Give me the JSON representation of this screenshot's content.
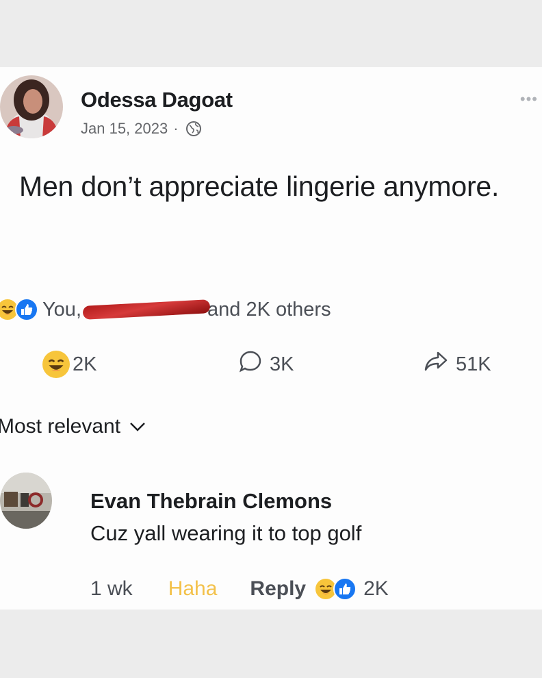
{
  "post": {
    "author": "Odessa Dagoat",
    "date": "Jan 15, 2023",
    "separator": "·",
    "privacy_icon": "globe-icon",
    "text": "Men don’t appreciate lingerie anymore.",
    "more_icon": "more-options-icon"
  },
  "reactions_summary": {
    "prefix": "You,",
    "suffix": "and 2K others",
    "icons": [
      "haha-icon",
      "like-icon"
    ]
  },
  "actions": {
    "haha_count": "2K",
    "comment_count": "3K",
    "share_count": "51K"
  },
  "comments_sort": {
    "label": "Most relevant"
  },
  "comment": {
    "author": "Evan Thebrain Clemons",
    "text": "Cuz yall wearing it to top golf",
    "time": "1 wk",
    "haha_label": "Haha",
    "reply_label": "Reply",
    "reaction_count": "2K"
  },
  "colors": {
    "like_blue": "#1877f2",
    "haha_yellow": "#f7c53b",
    "secondary_text": "#65676b",
    "redaction_red": "#c42a2a"
  }
}
